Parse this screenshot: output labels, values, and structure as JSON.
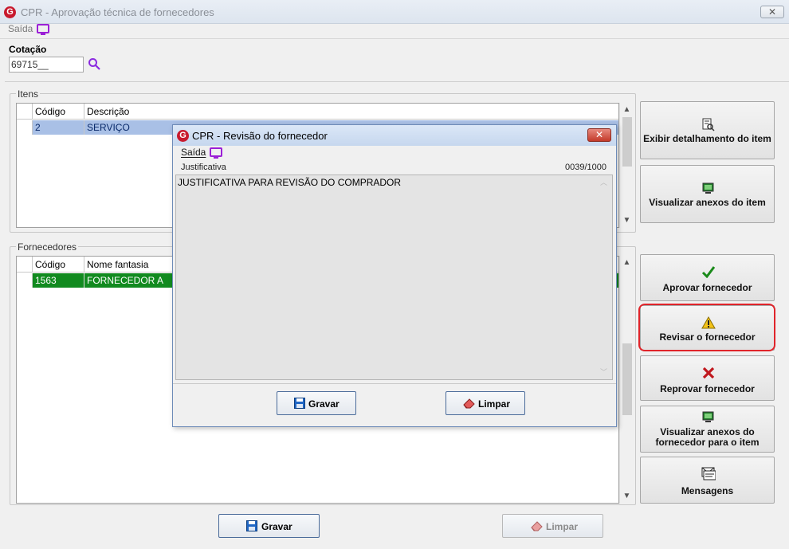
{
  "main_window": {
    "title": "CPR - Aprovação técnica de fornecedores",
    "close_glyph": "✕",
    "menu": {
      "saida": "Saída"
    }
  },
  "cotacao": {
    "label": "Cotação",
    "value": "69715__"
  },
  "itens": {
    "group_label": "Itens",
    "columns": [
      "Código",
      "Descrição"
    ],
    "rows": [
      {
        "codigo": "2",
        "descricao": "SERVIÇO"
      }
    ]
  },
  "fornecedores": {
    "group_label": "Fornecedores",
    "columns": [
      "Código",
      "Nome fantasia"
    ],
    "rows": [
      {
        "codigo": "1563",
        "nome": "FORNECEDOR A"
      }
    ]
  },
  "side_buttons": {
    "exibir_detalhamento": "Exibir detalhamento do item",
    "visualizar_anexos_item": "Visualizar anexos do item",
    "aprovar": "Aprovar fornecedor",
    "revisar": "Revisar o fornecedor",
    "reprovar": "Reprovar fornecedor",
    "visualizar_anexos_fornecedor_l1": "Visualizar anexos do",
    "visualizar_anexos_fornecedor_l2": "fornecedor para o item",
    "mensagens": "Mensagens"
  },
  "bottom_buttons": {
    "gravar": "Gravar",
    "limpar": "Limpar"
  },
  "dialog": {
    "title": "CPR - Revisão do fornecedor",
    "close_glyph": "✕",
    "menu_saida": "Saída",
    "justificativa_label": "Justificativa",
    "char_count": "0039/1000",
    "text": "JUSTIFICATIVA PARA REVISÃO DO COMPRADOR",
    "gravar": "Gravar",
    "limpar": "Limpar"
  },
  "colors": {
    "selected_item_row": "#a9c0e6",
    "selected_supplier_row": "#118a1f",
    "highlight": "#e0242a",
    "accent_purple": "#9b1fd6"
  },
  "icons": [
    "search-icon",
    "monitor-icon",
    "detail-icon",
    "attachment-icon",
    "check-icon",
    "warning-icon",
    "x-icon",
    "messages-icon",
    "save-icon",
    "eraser-icon"
  ]
}
